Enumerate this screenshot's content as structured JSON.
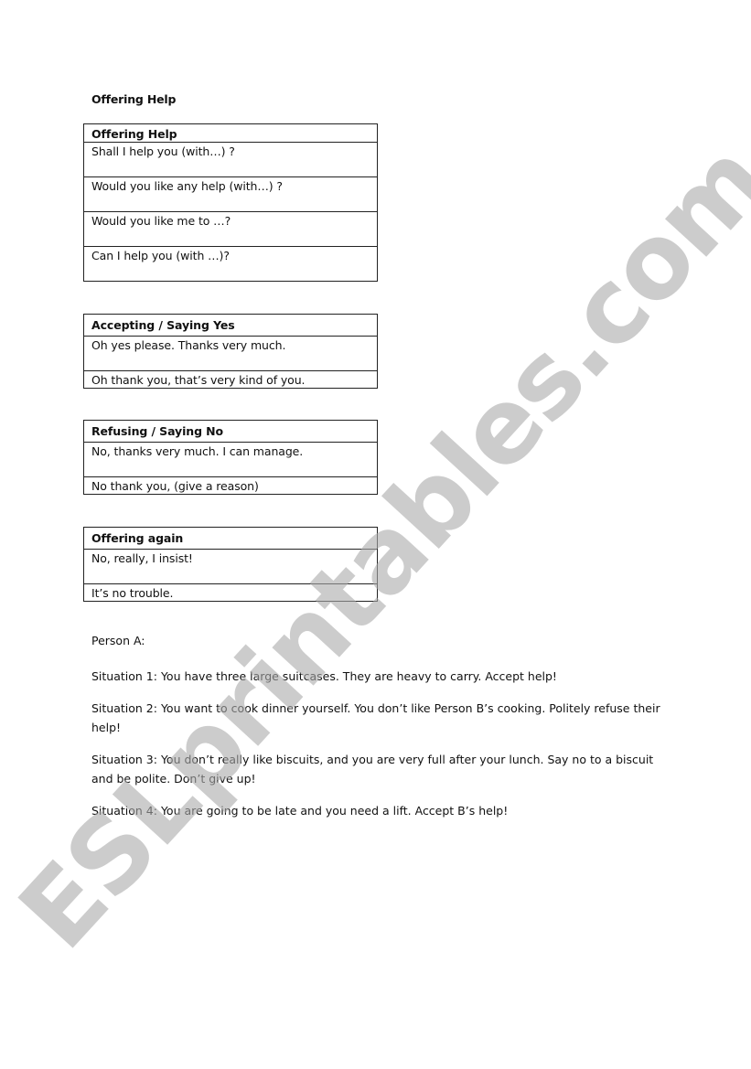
{
  "document": {
    "title": "Offering Help",
    "watermark": "ESLprintables.com"
  },
  "tables": [
    {
      "header": "Offering Help",
      "rows": [
        "Shall I help you (with…) ?",
        "Would you like any help (with…) ?",
        "Would you like me to …?",
        "Can I help you (with …)?"
      ]
    },
    {
      "header": "Accepting / Saying Yes",
      "rows": [
        "Oh yes please. Thanks very much.",
        "Oh thank you, that’s very kind of you."
      ]
    },
    {
      "header": "Refusing / Saying No",
      "rows": [
        "No, thanks very much. I can manage.",
        "No thank you, (give a reason)"
      ]
    },
    {
      "header": "Offering again",
      "rows": [
        "No, really, I insist!",
        "It’s no trouble."
      ]
    }
  ],
  "person_label": "Person A:",
  "situations": [
    "Situation 1: You have three large suitcases. They are heavy to carry. Accept help!",
    "Situation 2: You want to cook dinner yourself. You don’t like Person B’s cooking. Politely refuse their help!",
    "Situation 3: You don’t really like biscuits, and you are very full after your lunch. Say no to a biscuit and be polite. Don’t give up!",
    "Situation 4: You are going to be late and you need a lift. Accept B’s help!"
  ]
}
